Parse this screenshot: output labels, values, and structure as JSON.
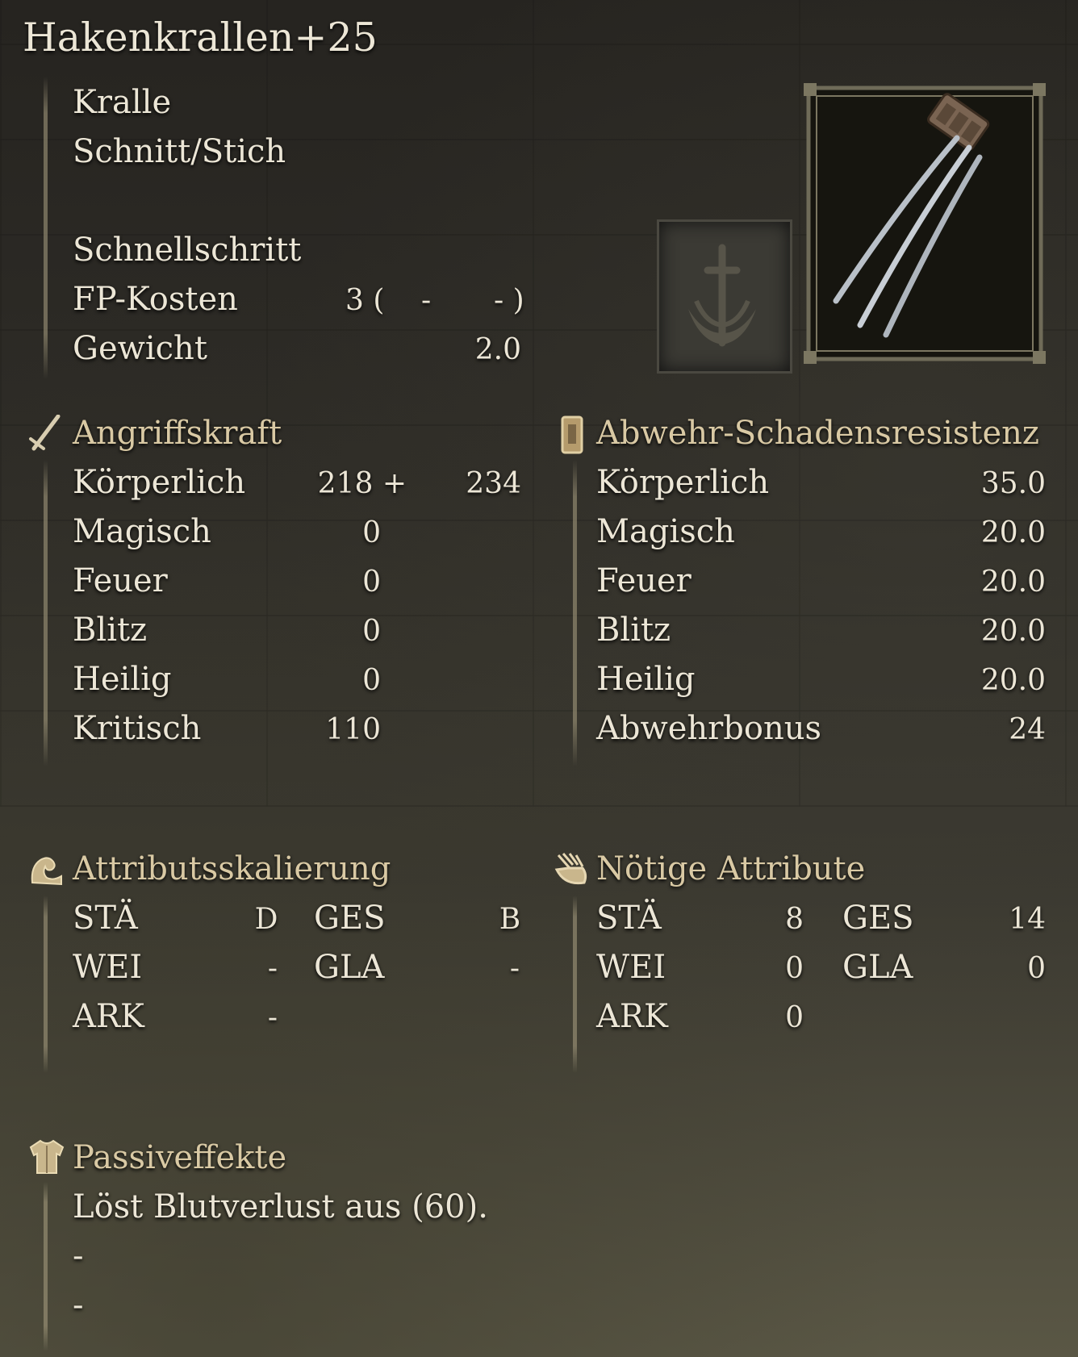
{
  "item": {
    "name": "Hakenkrallen+25",
    "weapon_type": "Kralle",
    "damage_type": "Schnitt/Stich",
    "skill": "Schnellschritt",
    "fp_label": "FP-Kosten",
    "fp_cost": "3 (",
    "fp_dash1": "-",
    "fp_dash2": "- )",
    "weight_label": "Gewicht",
    "weight": "2.0"
  },
  "attack": {
    "title": "Angriffskraft",
    "rows": [
      {
        "label": "Körperlich",
        "value": "218 +",
        "extra": "234"
      },
      {
        "label": "Magisch",
        "value": "0"
      },
      {
        "label": "Feuer",
        "value": "0"
      },
      {
        "label": "Blitz",
        "value": "0"
      },
      {
        "label": "Heilig",
        "value": "0"
      },
      {
        "label": "Kritisch",
        "value": "110"
      }
    ]
  },
  "defense": {
    "title": "Abwehr-Schadensresistenz",
    "rows": [
      {
        "label": "Körperlich",
        "value": "35.0"
      },
      {
        "label": "Magisch",
        "value": "20.0"
      },
      {
        "label": "Feuer",
        "value": "20.0"
      },
      {
        "label": "Blitz",
        "value": "20.0"
      },
      {
        "label": "Heilig",
        "value": "20.0"
      },
      {
        "label": "Abwehrbonus",
        "value": "24"
      }
    ]
  },
  "scaling": {
    "title": "Attributsskalierung",
    "rows": [
      {
        "a": "STÄ",
        "av": "D",
        "b": "GES",
        "bv": "B"
      },
      {
        "a": "WEI",
        "av": "-",
        "b": "GLA",
        "bv": "-"
      },
      {
        "a": "ARK",
        "av": "-"
      }
    ]
  },
  "requirements": {
    "title": "Nötige Attribute",
    "rows": [
      {
        "a": "STÄ",
        "av": "8",
        "b": "GES",
        "bv": "14"
      },
      {
        "a": "WEI",
        "av": "0",
        "b": "GLA",
        "bv": "0"
      },
      {
        "a": "ARK",
        "av": "0"
      }
    ]
  },
  "passive": {
    "title": "Passiveffekte",
    "lines": [
      "Löst Blutverlust aus (60).",
      "-",
      "-"
    ]
  },
  "icons": {
    "attack": "sword-icon",
    "defense": "shield-icon",
    "scaling": "flexed-arm-icon",
    "requirements": "hand-icon",
    "passive": "armor-icon",
    "affinity": "sword-affinity-icon",
    "weapon": "claw-weapon-image"
  }
}
